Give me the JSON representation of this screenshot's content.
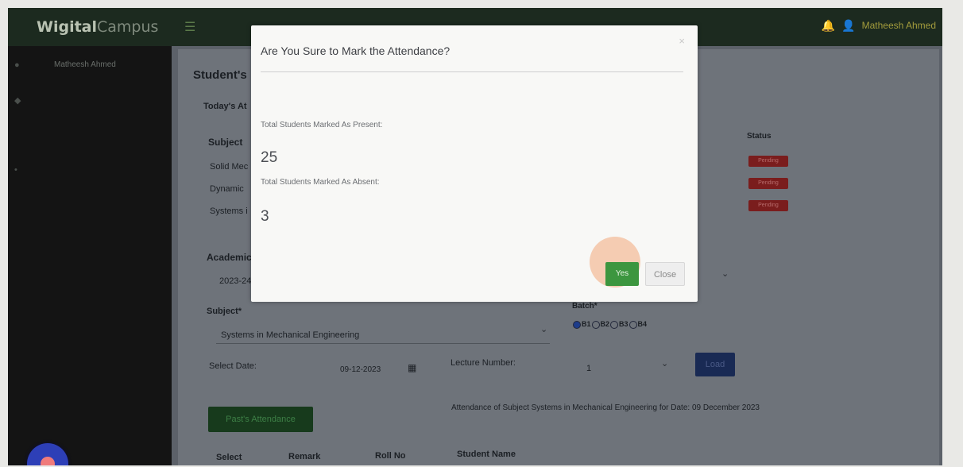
{
  "app": {
    "brand_part1": "Wigital",
    "brand_part2": "Campus",
    "user_name": "Matheesh Ahmed"
  },
  "topbar": {
    "menu_icon": "hamburger-icon",
    "notification_icon": "bell-icon",
    "user_icon": "user-icon"
  },
  "sidebar": {
    "user_name": "Matheesh Ahmed"
  },
  "page": {
    "title": "Student's",
    "todays_heading": "Today's At"
  },
  "subjects_table": {
    "header_subject": "Subject",
    "header_status": "Status",
    "rows": [
      {
        "subject": "Solid Mec",
        "status": "Pending"
      },
      {
        "subject": "Dynamic",
        "status": "Pending"
      },
      {
        "subject": "Systems i",
        "status": "Pending"
      }
    ]
  },
  "form": {
    "academic_label": "Academic",
    "academic_value": "2023-24",
    "subject_label": "Subject*",
    "subject_value": "Systems in Mechanical Engineering",
    "batch_label": "Batch*",
    "batch_options": [
      "B1",
      "B2",
      "B3",
      "B4"
    ],
    "batch_selected": "B1",
    "date_label": "Select Date:",
    "date_value": "09-12-2023",
    "lecture_label": "Lecture Number:",
    "lecture_value": "1",
    "load_button": "Load",
    "past_attendance_button": "Past's Attendance",
    "attendance_caption": "Attendance of Subject Systems in Mechanical Engineering for Date: 09 December 2023"
  },
  "attendance_table": {
    "headers": [
      "Select",
      "Remark",
      "Roll No",
      "Student Name"
    ]
  },
  "modal": {
    "title": "Are You Sure to Mark the Attendance?",
    "close_glyph": "×",
    "present_label": "Total Students Marked As Present:",
    "present_count": "25",
    "absent_label": "Total Students Marked As Absent:",
    "absent_count": "3",
    "yes_button": "Yes",
    "close_button": "Close"
  },
  "colors": {
    "primary_green": "#3c963f",
    "pending_red": "#7a1d1d",
    "load_blue": "#192a54"
  }
}
